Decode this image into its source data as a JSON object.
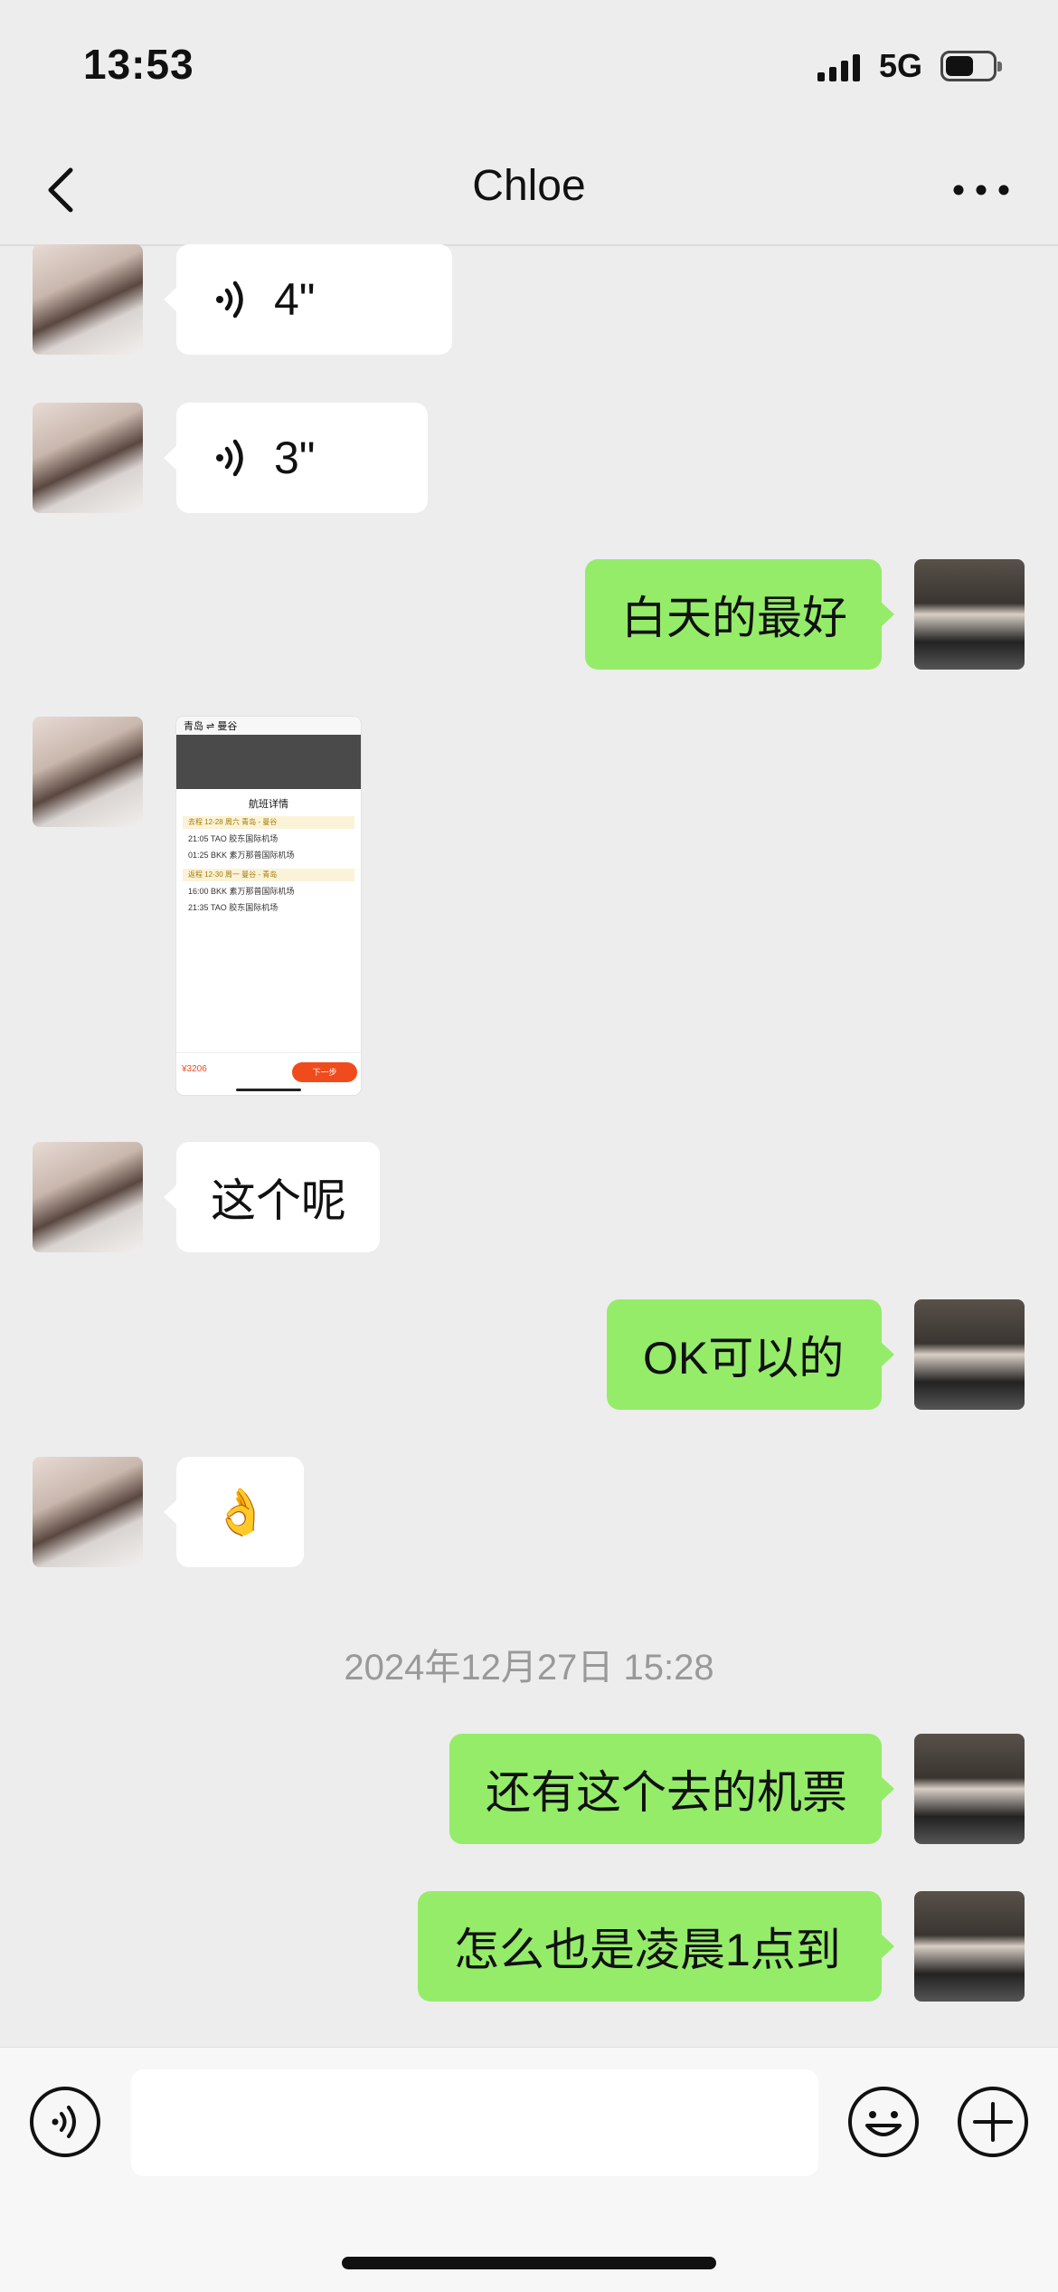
{
  "status_bar": {
    "time": "13:53",
    "network": "5G",
    "battery_level": 0.6
  },
  "nav": {
    "back_icon": "chevron-left-icon",
    "title": "Chloe",
    "more_icon": "more-horizontal-icon"
  },
  "messages": [
    {
      "side": "left",
      "type": "voice",
      "duration": "4\""
    },
    {
      "side": "left",
      "type": "voice",
      "duration": "3\""
    },
    {
      "side": "right",
      "type": "text",
      "text": "白天的最好"
    },
    {
      "side": "left",
      "type": "image",
      "image": {
        "route": "青岛 ⇌ 曼谷",
        "sheet_title": "航班详情",
        "rows": [
          "21:05  TAO 胶东国际机场",
          "01:25  BKK 素万那普国际机场",
          "16:00  BKK 素万那普国际机场",
          "21:35  TAO 胶东国际机场"
        ],
        "segments": [
          "去程 12-28 周六 青岛 - 曼谷",
          "返程 12-30 周一 曼谷 - 青岛"
        ],
        "price": "¥3206",
        "next_button": "下一步"
      }
    },
    {
      "side": "left",
      "type": "text",
      "text": "这个呢"
    },
    {
      "side": "right",
      "type": "text",
      "text": "OK可以的"
    },
    {
      "side": "left",
      "type": "text",
      "text": "👌"
    },
    {
      "side": "right",
      "type": "text",
      "text": "还有这个去的机票"
    },
    {
      "side": "right",
      "type": "text",
      "text": "怎么也是凌晨1点到"
    }
  ],
  "timestamp": "2024年12月27日 15:28",
  "input_bar": {
    "voice_icon": "voice-mode-icon",
    "text_value": "",
    "emoji_icon": "emoji-icon",
    "plus_icon": "plus-icon"
  }
}
